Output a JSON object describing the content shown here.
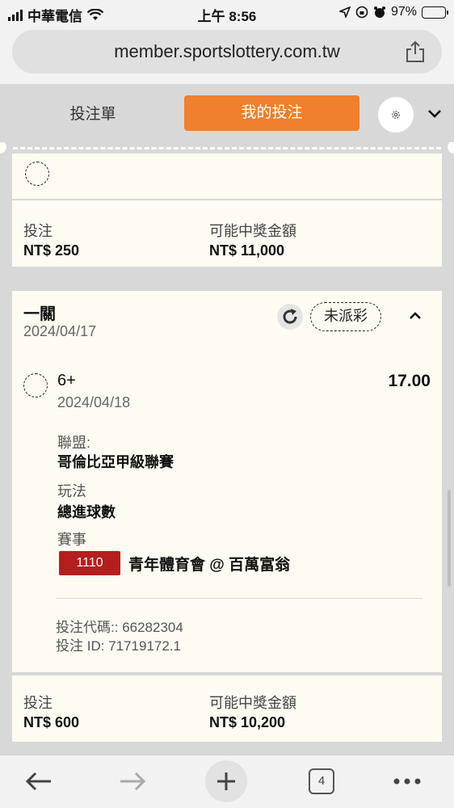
{
  "status_bar": {
    "carrier": "中華電信",
    "time": "上午 8:56",
    "battery_percent": "97%",
    "battery_level": 0.97
  },
  "browser": {
    "url": "member.sportslottery.com.tw",
    "tab_count": "4"
  },
  "tabs": {
    "bet_slip": "投注單",
    "my_bets": "我的投注"
  },
  "previous_bet": {
    "stake_label": "投注",
    "stake": "NT$ 250",
    "payout_label": "可能中獎金額",
    "payout": "NT$ 11,000"
  },
  "bet": {
    "type": "一關",
    "date": "2024/04/17",
    "status": "未派彩",
    "selection": {
      "pick": "6+",
      "event_date": "2024/04/18",
      "odds": "17.00",
      "league_label": "聯盟:",
      "league": "哥倫比亞甲級聯賽",
      "market_label": "玩法",
      "market": "總進球數",
      "match_label": "賽事",
      "match_code": "1110",
      "match": "青年體育會 @ 百萬富翁"
    },
    "bet_code_label": "投注代碼::",
    "bet_code": "66282304",
    "bet_id_label": "投注 ID:",
    "bet_id": "71719172.1",
    "stake_label": "投注",
    "stake": "NT$ 600",
    "payout_label": "可能中獎金額",
    "payout": "NT$ 10,200"
  },
  "colors": {
    "accent": "#f0802d",
    "tag": "#b41e1e",
    "card": "#fdfbf2"
  }
}
